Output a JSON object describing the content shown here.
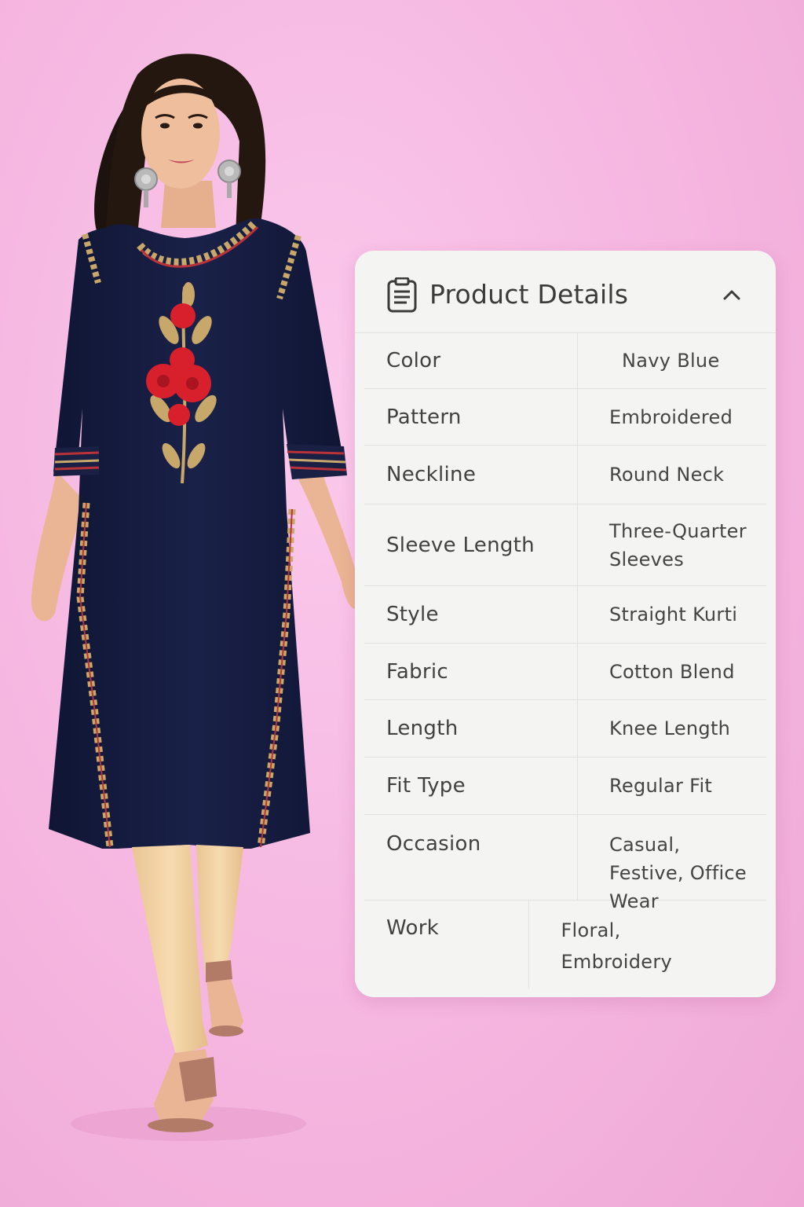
{
  "panel": {
    "title": "Product Details",
    "header_icon": "document-icon",
    "toggle_icon": "chevron-up-icon"
  },
  "details": [
    {
      "label": "Color",
      "value": "Navy Blue"
    },
    {
      "label": "Pattern",
      "value": "Embroidered"
    },
    {
      "label": "Neckline",
      "value": "Round Neck"
    },
    {
      "label": "Sleeve Length",
      "value": "Three-Quarter Sleeves"
    },
    {
      "label": "Style",
      "value": "Straight Kurti"
    },
    {
      "label": "Fabric",
      "value": "Cotton Blend"
    },
    {
      "label": "Length",
      "value": "Knee Length"
    },
    {
      "label": "Fit Type",
      "value": "Regular Fit"
    },
    {
      "label": "Occasion",
      "value": "Casual, Festive, Office Wear"
    },
    {
      "label": "Work",
      "value": "Floral, Embroidery"
    }
  ],
  "colors": {
    "background": "#f5b6e0",
    "kurti": "#141a3a",
    "embroidery_red": "#d8202c",
    "embroidery_gold": "#c8a86a",
    "leggings": "#f5d6a8",
    "panel_bg": "#f4f4f3"
  }
}
